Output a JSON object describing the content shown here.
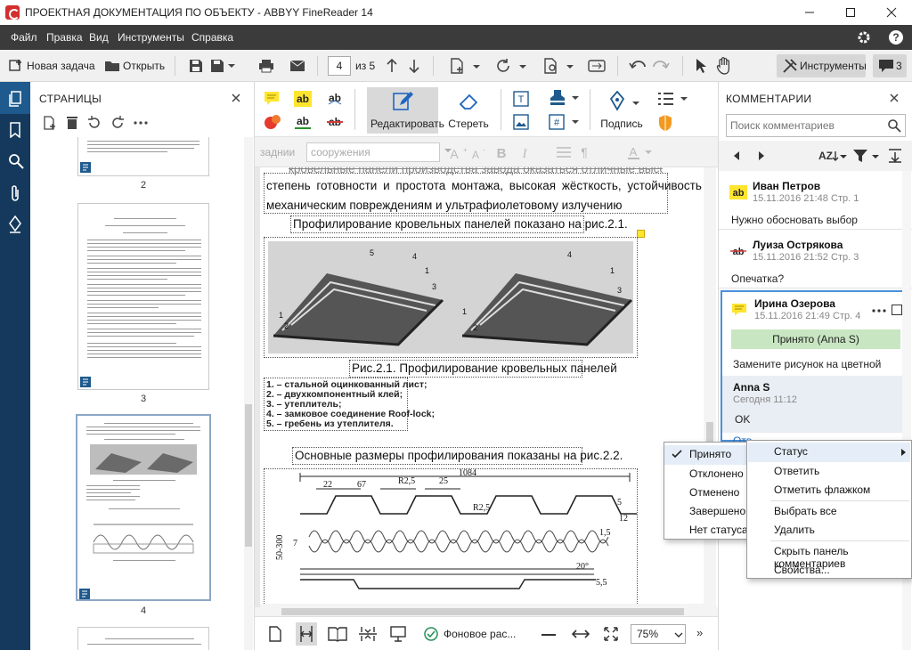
{
  "window": {
    "title": "ПРОЕКТНАЯ ДОКУМЕНТАЦИЯ ПО ОБЪЕКТУ - ABBYY FineReader 14"
  },
  "menu": [
    "Файл",
    "Правка",
    "Вид",
    "Инструменты",
    "Справка"
  ],
  "toolbar": {
    "new_task": "Новая задача",
    "open": "Открыть",
    "page_current": "4",
    "page_total": "из 5",
    "tools": "Инструменты",
    "comments_count": "3"
  },
  "pages_panel": {
    "title": "СТРАНИЦЫ",
    "page_numbers": [
      "2",
      "3",
      "4"
    ]
  },
  "doc_tools": {
    "edit": "Редактировать",
    "erase": "Стереть",
    "signature": "Подпись"
  },
  "format_bar": {
    "style": "заднии",
    "font": "сооружения"
  },
  "document": {
    "para_top": "кровельные панели производства завода оказаться отличные высокая",
    "line1": "степень готовности и простота монтажа, высокая жёсткость, устойчивость к",
    "line2": "механическим повреждениям и ультрафиолетовому излучению",
    "line3": "Профилирование кровельных панелей показано на рис.2.1.",
    "caption": "Рис.2.1.  Профилирование кровельных панелей",
    "list": [
      "1. – стальной оцинкованный лист;",
      "2. – двухкомпонентный клей;",
      "3. – утеплитель;",
      "4. – замковое соединение Roof-lock;",
      "5. – гребень из утеплителя."
    ],
    "sizes_line": "Основные размеры профилирования показаны на рис.2.2.",
    "dims": [
      "1084",
      "22",
      "67",
      "R2,5",
      "25",
      "R2,5",
      "12",
      "5",
      "1,5",
      "50-300",
      "7",
      "20°",
      "5,5"
    ]
  },
  "status_bar": {
    "background": "Фоновое рас...",
    "zoom": "75%"
  },
  "comments_panel": {
    "title": "КОММЕНТАРИИ",
    "search_placeholder": "Поиск комментариев",
    "items": [
      {
        "author": "Иван Петров",
        "date": "15.11.2016 21:48",
        "page": "Стр. 1",
        "text": "Нужно обосновать выбор"
      },
      {
        "author": "Луиза Острякова",
        "date": "15.11.2016 21:52",
        "page": "Стр. 3",
        "text": "Опечатка?"
      },
      {
        "author": "Ирина Озерова",
        "date": "15.11.2016 21:49",
        "page": "Стр. 4",
        "status": "Принято (Anna S)",
        "text": "Замените рисунок на цветной"
      }
    ],
    "reply": {
      "author": "Anna S",
      "date": "Сегодня 11:12",
      "text": "OK"
    },
    "partial": "Отв"
  },
  "context_menu": {
    "items": [
      "Статус",
      "Ответить",
      "Отметить флажком",
      "Выбрать все",
      "Удалить",
      "Скрыть панель комментариев",
      "Свойства..."
    ]
  },
  "status_submenu": {
    "items": [
      "Принято",
      "Отклонено",
      "Отменено",
      "Завершено",
      "Нет статуса"
    ],
    "checked": "Принято"
  },
  "colors": {
    "menubar": "#3b3b3b",
    "rail": "#14395c",
    "accepted": "#c8e6c1",
    "selected_border": "#4a90d9",
    "sticky": "#ffe52e"
  }
}
